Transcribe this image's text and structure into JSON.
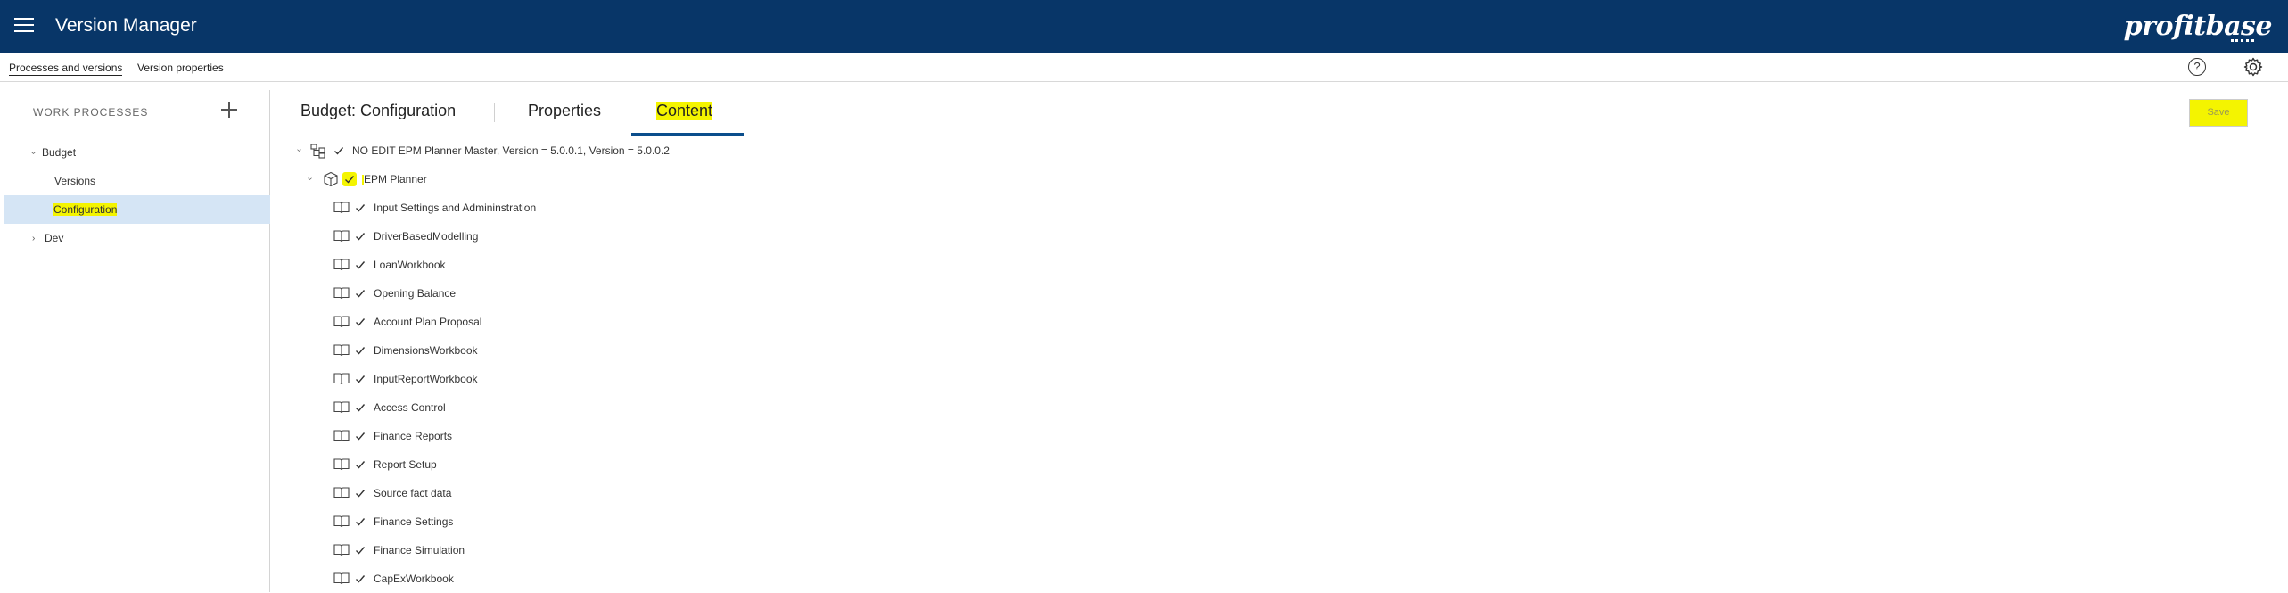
{
  "header": {
    "title": "Version Manager",
    "brand": "profitbase"
  },
  "subnav": {
    "tabs": [
      "Processes and versions",
      "Version properties"
    ],
    "help_glyph": "?"
  },
  "sidebar": {
    "heading": "WORK PROCESSES",
    "items": [
      {
        "label": "Budget",
        "chevron": "›",
        "expanded": true
      },
      {
        "label": "Versions"
      },
      {
        "label": "Configuration",
        "selected": true
      },
      {
        "label": "Dev",
        "chevron": "›",
        "expanded": false
      }
    ]
  },
  "main": {
    "title": "Budget: Configuration",
    "tabs": [
      "Properties",
      "Content"
    ],
    "active_tab": "Content",
    "save_label": "Save",
    "root": {
      "label": "NO EDIT EPM Planner Master, Version = 5.0.0.1, Version = 5.0.0.2",
      "checked": true
    },
    "package": {
      "label": "EPM Planner",
      "checked": true
    },
    "workbooks": [
      {
        "label": "Input Settings and Admininstration",
        "checked": true
      },
      {
        "label": "DriverBasedModelling",
        "checked": true
      },
      {
        "label": "LoanWorkbook",
        "checked": true
      },
      {
        "label": "Opening Balance",
        "checked": true
      },
      {
        "label": "Account Plan Proposal",
        "checked": true
      },
      {
        "label": "DimensionsWorkbook",
        "checked": true
      },
      {
        "label": "InputReportWorkbook",
        "checked": true
      },
      {
        "label": "Access Control",
        "checked": true
      },
      {
        "label": "Finance Reports",
        "checked": true
      },
      {
        "label": "Report Setup",
        "checked": true
      },
      {
        "label": "Source fact data",
        "checked": true
      },
      {
        "label": "Finance Settings",
        "checked": true
      },
      {
        "label": "Finance Simulation",
        "checked": true
      },
      {
        "label": "CapExWorkbook",
        "checked": true
      }
    ]
  },
  "colors": {
    "header_bg": "#083668",
    "tab_accent": "#0b4e8c",
    "selected_row": "#d5e5f5",
    "highlight": "#f4f400"
  }
}
